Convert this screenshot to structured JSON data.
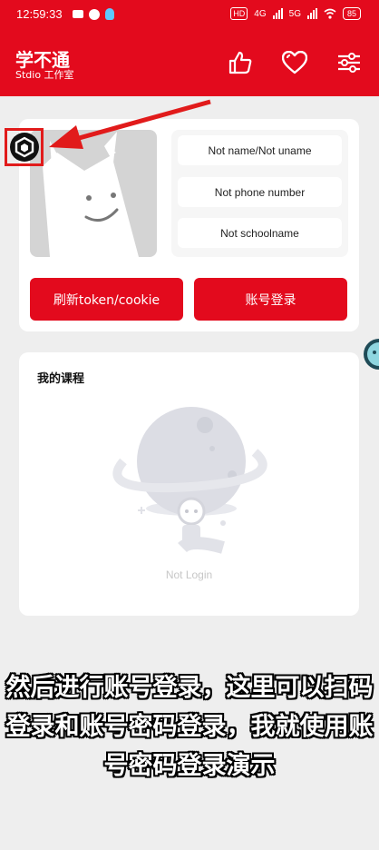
{
  "status_bar": {
    "time": "12:59:33",
    "hd_label": "HD",
    "network_4g": "4G",
    "network_5g": "5G",
    "battery": "85"
  },
  "app_bar": {
    "title": "学不通",
    "subtitle": "Stdio 工作室",
    "actions": [
      "thumbs-up-icon",
      "heart-icon",
      "sliders-icon"
    ]
  },
  "profile": {
    "name": "Not name/Not uname",
    "phone": "Not phone number",
    "school": "Not schoolname"
  },
  "buttons": {
    "refresh": "刷新token/cookie",
    "login": "账号登录"
  },
  "courses": {
    "title": "我的课程",
    "empty_text": "Not Login"
  },
  "caption": {
    "line1": "然后进行账号登录，这里可以扫码",
    "line2": "登录和账号密码登录，我就使用账",
    "line3": "号密码登录演示"
  },
  "colors": {
    "brand_red": "#e30a1d",
    "annotation_red": "#e11b1b"
  }
}
